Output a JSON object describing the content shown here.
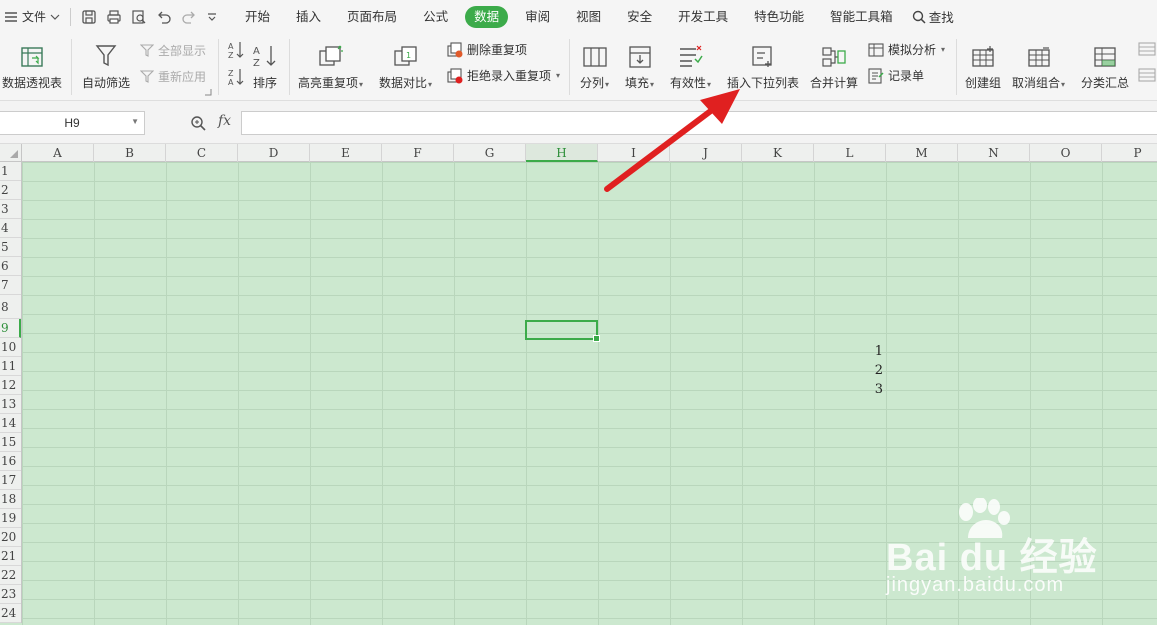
{
  "menu": {
    "file_label": "文件",
    "tabs": [
      "开始",
      "插入",
      "页面布局",
      "公式",
      "数据",
      "审阅",
      "视图",
      "安全",
      "开发工具",
      "特色功能",
      "智能工具箱"
    ],
    "active_tab": "数据",
    "search_label": "查找"
  },
  "ribbon": {
    "pivot": "数据透视表",
    "autofilter": "自动筛选",
    "show_all": "全部显示",
    "reapply": "重新应用",
    "sort": "排序",
    "highlight_dup": "高亮重复项",
    "compare": "数据对比",
    "delete_dup": "删除重复项",
    "reject_dup": "拒绝录入重复项",
    "split": "分列",
    "fill": "填充",
    "validity": "有效性",
    "insert_dropdown": "插入下拉列表",
    "merge_calc": "合并计算",
    "whatif": "模拟分析",
    "record": "记录单",
    "create_group": "创建组",
    "ungroup": "取消组合",
    "subtotal": "分类汇总"
  },
  "formula_bar": {
    "name_box": "H9",
    "fx_label": "fx",
    "formula": ""
  },
  "sheet": {
    "columns": [
      "A",
      "B",
      "C",
      "D",
      "E",
      "F",
      "G",
      "H",
      "I",
      "J",
      "K",
      "L",
      "M",
      "N",
      "O",
      "P"
    ],
    "rows": [
      "1",
      "2",
      "3",
      "4",
      "5",
      "6",
      "7",
      "8",
      "9",
      "10",
      "11",
      "12",
      "13",
      "14",
      "15",
      "16",
      "17",
      "18",
      "19",
      "20",
      "21",
      "22",
      "23",
      "24"
    ],
    "selected_column": "H",
    "selected_row": "9",
    "cells": {
      "L10": "1",
      "L11": "2",
      "L12": "3"
    }
  },
  "watermark": {
    "brand": "Bai du 经验",
    "url": "jingyan.baidu.com"
  },
  "colors": {
    "accent": "#3cab4a",
    "sheet_bg": "#cce8cf",
    "arrow": "#e02020"
  }
}
